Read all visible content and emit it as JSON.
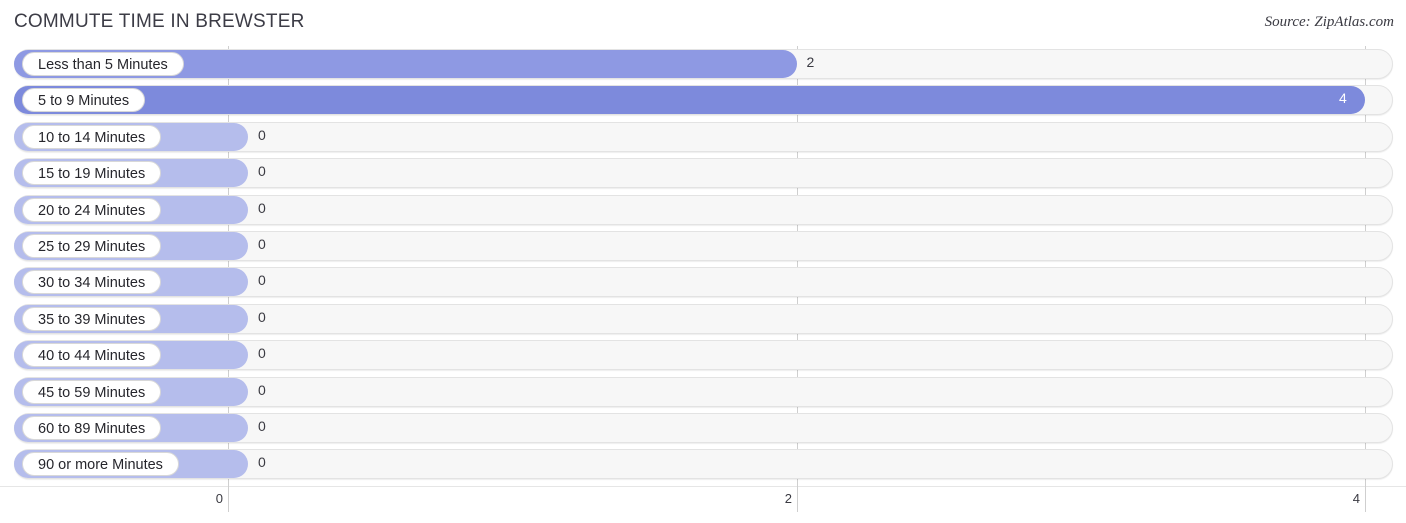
{
  "header": {
    "title": "COMMUTE TIME IN BREWSTER",
    "source": "Source: ZipAtlas.com"
  },
  "chart_data": {
    "type": "bar",
    "orientation": "horizontal",
    "title": "COMMUTE TIME IN BREWSTER",
    "xlabel": "",
    "ylabel": "",
    "xlim": [
      0,
      4
    ],
    "grid": true,
    "legend": "none",
    "axis_ticks": [
      "0",
      "2",
      "4"
    ],
    "axis_tick_values": [
      0,
      2,
      4
    ],
    "categories": [
      "Less than 5 Minutes",
      "5 to 9 Minutes",
      "10 to 14 Minutes",
      "15 to 19 Minutes",
      "20 to 24 Minutes",
      "25 to 29 Minutes",
      "30 to 34 Minutes",
      "35 to 39 Minutes",
      "40 to 44 Minutes",
      "45 to 59 Minutes",
      "60 to 89 Minutes",
      "90 or more Minutes"
    ],
    "values": [
      2,
      4,
      0,
      0,
      0,
      0,
      0,
      0,
      0,
      0,
      0,
      0
    ],
    "value_labels": [
      "2",
      "4",
      "0",
      "0",
      "0",
      "0",
      "0",
      "0",
      "0",
      "0",
      "0",
      "0"
    ],
    "colors": {
      "bar": "#8e99e3",
      "bar_full": "#7d8adc",
      "bar_zero": "#b5bdec",
      "track": "#f7f7f7",
      "gridline": "#cfcfcf",
      "text": "#3a3a42"
    }
  },
  "rows": [
    {
      "label": "Less than 5 Minutes",
      "value": "2",
      "inside": false
    },
    {
      "label": "5 to 9 Minutes",
      "value": "4",
      "inside": true
    },
    {
      "label": "10 to 14 Minutes",
      "value": "0",
      "inside": false
    },
    {
      "label": "15 to 19 Minutes",
      "value": "0",
      "inside": false
    },
    {
      "label": "20 to 24 Minutes",
      "value": "0",
      "inside": false
    },
    {
      "label": "25 to 29 Minutes",
      "value": "0",
      "inside": false
    },
    {
      "label": "30 to 34 Minutes",
      "value": "0",
      "inside": false
    },
    {
      "label": "35 to 39 Minutes",
      "value": "0",
      "inside": false
    },
    {
      "label": "40 to 44 Minutes",
      "value": "0",
      "inside": false
    },
    {
      "label": "45 to 59 Minutes",
      "value": "0",
      "inside": false
    },
    {
      "label": "60 to 89 Minutes",
      "value": "0",
      "inside": false
    },
    {
      "label": "90 or more Minutes",
      "value": "0",
      "inside": false
    }
  ]
}
